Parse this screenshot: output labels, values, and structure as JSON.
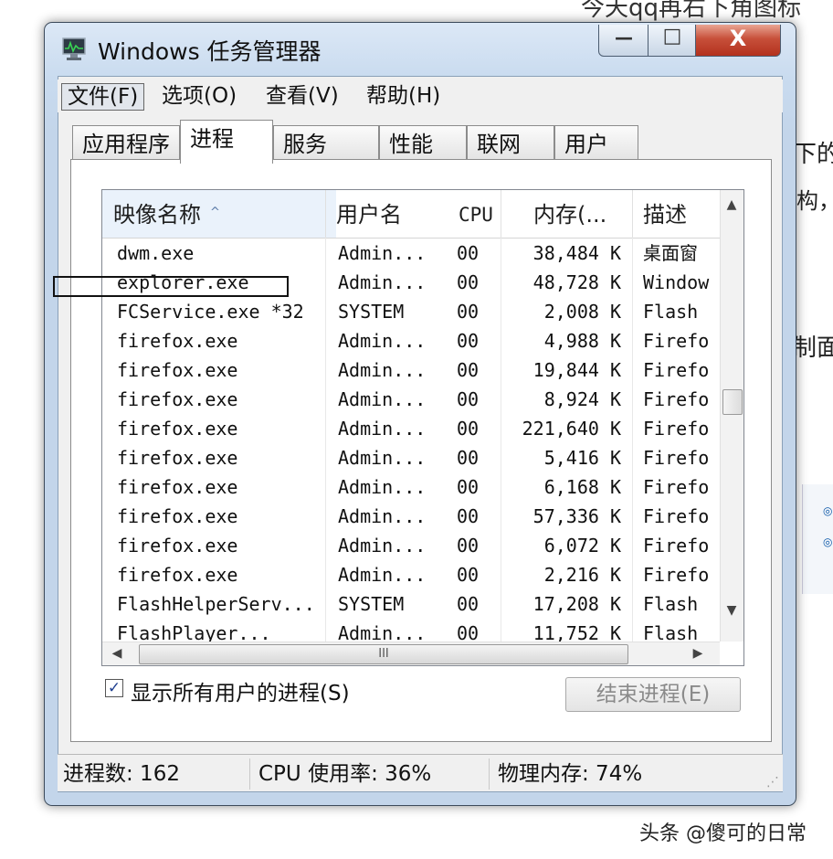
{
  "background": {
    "top_text": "今天qq再右下角图标",
    "right_fragments": [
      "下的",
      "构，",
      "制面"
    ],
    "side_panel_marks": [
      "◎",
      "◎"
    ],
    "watermark": "头条 @傻可的日常"
  },
  "window": {
    "title": "Windows 任务管理器",
    "icon": "task-manager-monitor-icon",
    "controls": {
      "minimize": "—",
      "maximize": "□",
      "close": "X"
    }
  },
  "menu": {
    "items": [
      "文件(F)",
      "选项(O)",
      "查看(V)",
      "帮助(H)"
    ],
    "active_index": 0
  },
  "tabs": {
    "items": [
      "应用程序",
      "进程",
      "服务",
      "性能",
      "联网",
      "用户"
    ],
    "selected_index": 1
  },
  "process_list": {
    "columns": [
      "映像名称",
      "用户名",
      "CPU",
      "内存(...",
      "描述"
    ],
    "sorted_column": "映像名称",
    "rows": [
      {
        "name": "dwm.exe",
        "user": "Admin...",
        "cpu": "00",
        "mem": "38,484 K",
        "desc": "桌面窗"
      },
      {
        "name": "explorer.exe",
        "user": "Admin...",
        "cpu": "00",
        "mem": "48,728 K",
        "desc": "Window"
      },
      {
        "name": "FCService.exe *32",
        "user": "SYSTEM",
        "cpu": "00",
        "mem": "2,008 K",
        "desc": "Flash"
      },
      {
        "name": "firefox.exe",
        "user": "Admin...",
        "cpu": "00",
        "mem": "4,988 K",
        "desc": "Firefo"
      },
      {
        "name": "firefox.exe",
        "user": "Admin...",
        "cpu": "00",
        "mem": "19,844 K",
        "desc": "Firefo"
      },
      {
        "name": "firefox.exe",
        "user": "Admin...",
        "cpu": "00",
        "mem": "8,924 K",
        "desc": "Firefo"
      },
      {
        "name": "firefox.exe",
        "user": "Admin...",
        "cpu": "00",
        "mem": "221,640 K",
        "desc": "Firefo"
      },
      {
        "name": "firefox.exe",
        "user": "Admin...",
        "cpu": "00",
        "mem": "5,416 K",
        "desc": "Firefo"
      },
      {
        "name": "firefox.exe",
        "user": "Admin...",
        "cpu": "00",
        "mem": "6,168 K",
        "desc": "Firefo"
      },
      {
        "name": "firefox.exe",
        "user": "Admin...",
        "cpu": "00",
        "mem": "57,336 K",
        "desc": "Firefo"
      },
      {
        "name": "firefox.exe",
        "user": "Admin...",
        "cpu": "00",
        "mem": "6,072 K",
        "desc": "Firefo"
      },
      {
        "name": "firefox.exe",
        "user": "Admin...",
        "cpu": "00",
        "mem": "2,216 K",
        "desc": "Firefo"
      },
      {
        "name": "FlashHelperServ...",
        "user": "SYSTEM",
        "cpu": "00",
        "mem": "17,208 K",
        "desc": "Flash"
      },
      {
        "name": "FlashPlayer...",
        "user": "Admin...",
        "cpu": "00",
        "mem": "11,752 K",
        "desc": "Flash"
      }
    ],
    "hscroll_grip": "III"
  },
  "show_all_users": {
    "label": "显示所有用户的进程(S)",
    "checked": true
  },
  "end_process_label": "结束进程(E)",
  "status": {
    "processes": "进程数: 162",
    "cpu": "CPU 使用率: 36%",
    "memory": "物理内存: 74%"
  }
}
